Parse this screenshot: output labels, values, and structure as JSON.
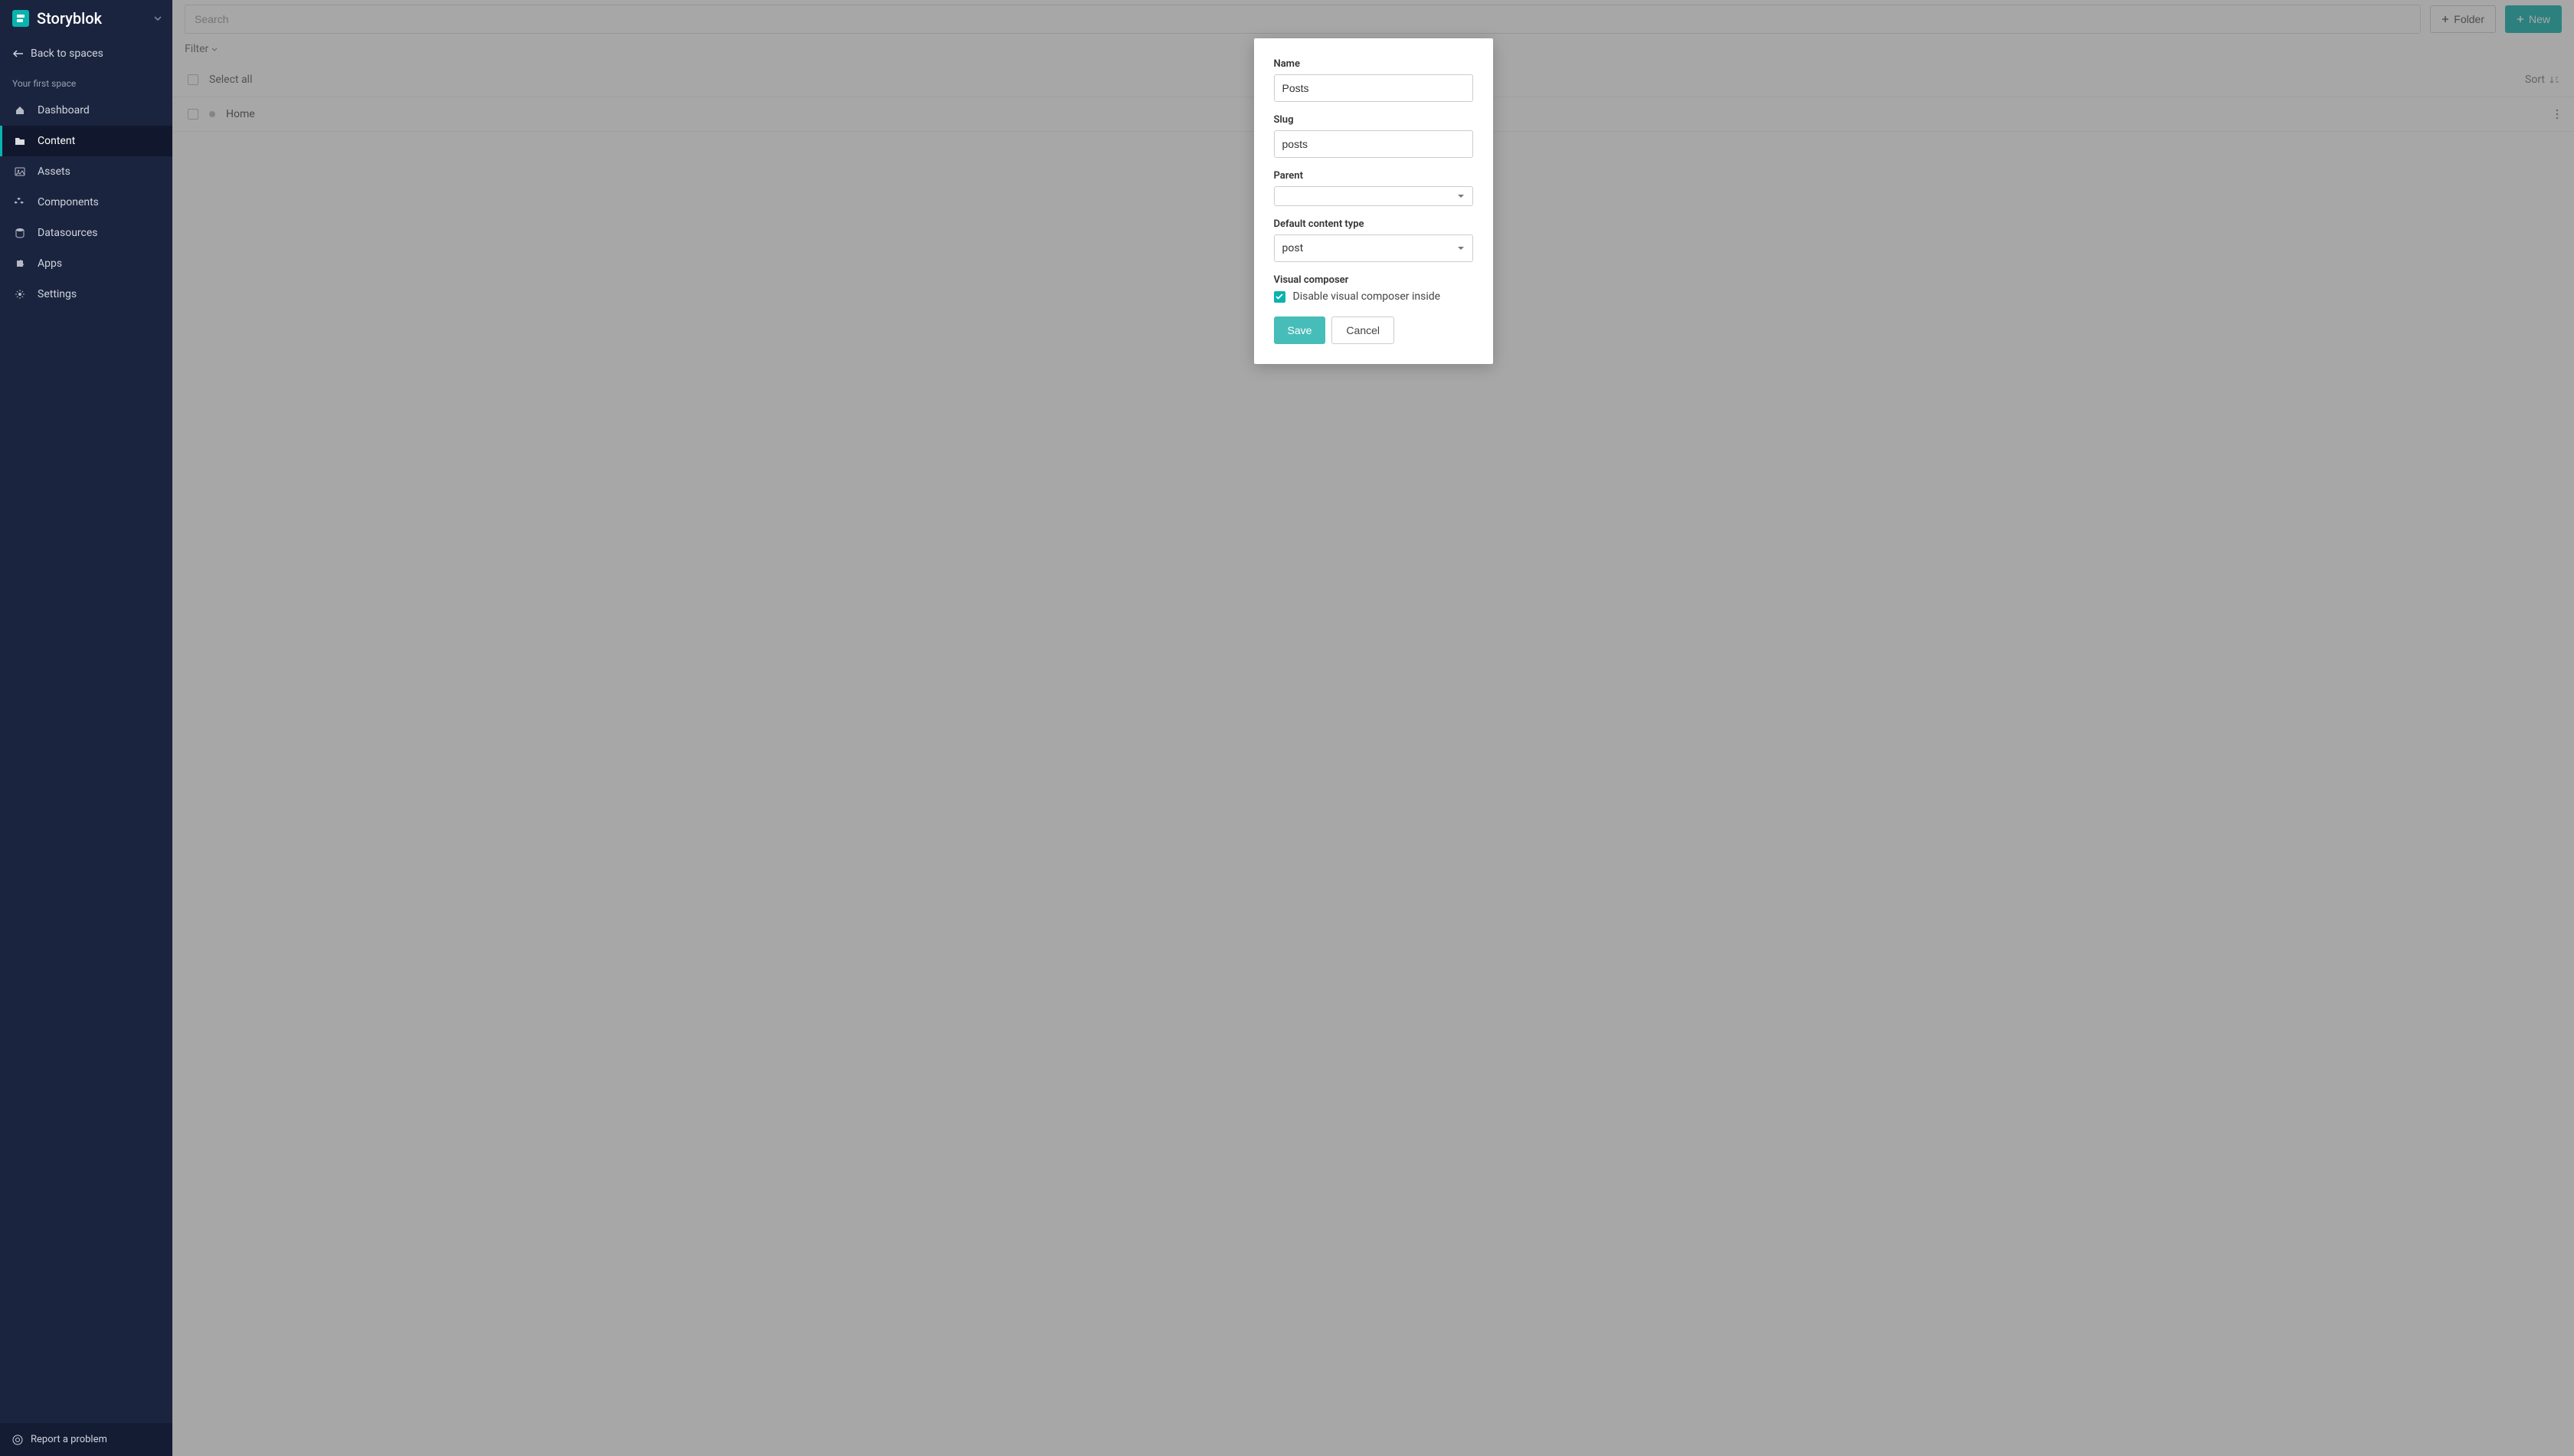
{
  "brand": {
    "name": "Storyblok"
  },
  "sidebar": {
    "back_label": "Back to spaces",
    "space_label": "Your first space",
    "items": [
      {
        "label": "Dashboard",
        "icon": "home-icon"
      },
      {
        "label": "Content",
        "icon": "folder-icon",
        "active": true
      },
      {
        "label": "Assets",
        "icon": "image-icon"
      },
      {
        "label": "Components",
        "icon": "cubes-icon"
      },
      {
        "label": "Datasources",
        "icon": "database-icon"
      },
      {
        "label": "Apps",
        "icon": "puzzle-icon"
      },
      {
        "label": "Settings",
        "icon": "gear-icon"
      }
    ],
    "footer_label": "Report a problem"
  },
  "topbar": {
    "search_placeholder": "Search",
    "folder_button": "Folder",
    "new_button": "New"
  },
  "filter": {
    "label": "Filter"
  },
  "list": {
    "select_all": "Select all",
    "sort_label": "Sort",
    "rows": [
      {
        "title": "Home"
      }
    ]
  },
  "modal": {
    "name_label": "Name",
    "name_value": "Posts",
    "slug_label": "Slug",
    "slug_value": "posts",
    "parent_label": "Parent",
    "parent_value": "",
    "content_type_label": "Default content type",
    "content_type_value": "post",
    "visual_label": "Visual composer",
    "visual_checkbox_label": "Disable visual composer inside",
    "visual_checked": true,
    "save_label": "Save",
    "cancel_label": "Cancel"
  }
}
